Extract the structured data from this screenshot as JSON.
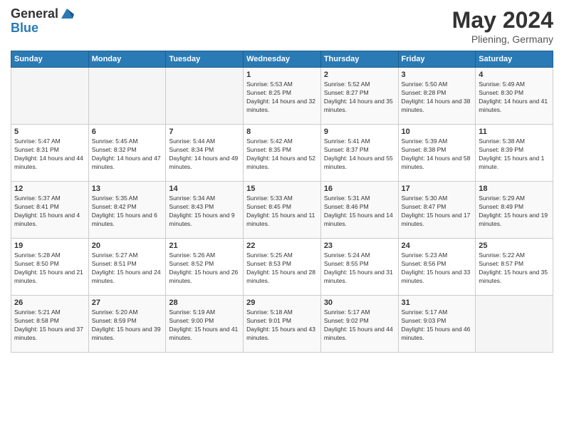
{
  "logo": {
    "general": "General",
    "blue": "Blue"
  },
  "title": {
    "month": "May 2024",
    "location": "Pliening, Germany"
  },
  "weekdays": [
    "Sunday",
    "Monday",
    "Tuesday",
    "Wednesday",
    "Thursday",
    "Friday",
    "Saturday"
  ],
  "weeks": [
    [
      {
        "day": "",
        "sunrise": "",
        "sunset": "",
        "daylight": ""
      },
      {
        "day": "",
        "sunrise": "",
        "sunset": "",
        "daylight": ""
      },
      {
        "day": "",
        "sunrise": "",
        "sunset": "",
        "daylight": ""
      },
      {
        "day": "1",
        "sunrise": "Sunrise: 5:53 AM",
        "sunset": "Sunset: 8:25 PM",
        "daylight": "Daylight: 14 hours and 32 minutes."
      },
      {
        "day": "2",
        "sunrise": "Sunrise: 5:52 AM",
        "sunset": "Sunset: 8:27 PM",
        "daylight": "Daylight: 14 hours and 35 minutes."
      },
      {
        "day": "3",
        "sunrise": "Sunrise: 5:50 AM",
        "sunset": "Sunset: 8:28 PM",
        "daylight": "Daylight: 14 hours and 38 minutes."
      },
      {
        "day": "4",
        "sunrise": "Sunrise: 5:49 AM",
        "sunset": "Sunset: 8:30 PM",
        "daylight": "Daylight: 14 hours and 41 minutes."
      }
    ],
    [
      {
        "day": "5",
        "sunrise": "Sunrise: 5:47 AM",
        "sunset": "Sunset: 8:31 PM",
        "daylight": "Daylight: 14 hours and 44 minutes."
      },
      {
        "day": "6",
        "sunrise": "Sunrise: 5:45 AM",
        "sunset": "Sunset: 8:32 PM",
        "daylight": "Daylight: 14 hours and 47 minutes."
      },
      {
        "day": "7",
        "sunrise": "Sunrise: 5:44 AM",
        "sunset": "Sunset: 8:34 PM",
        "daylight": "Daylight: 14 hours and 49 minutes."
      },
      {
        "day": "8",
        "sunrise": "Sunrise: 5:42 AM",
        "sunset": "Sunset: 8:35 PM",
        "daylight": "Daylight: 14 hours and 52 minutes."
      },
      {
        "day": "9",
        "sunrise": "Sunrise: 5:41 AM",
        "sunset": "Sunset: 8:37 PM",
        "daylight": "Daylight: 14 hours and 55 minutes."
      },
      {
        "day": "10",
        "sunrise": "Sunrise: 5:39 AM",
        "sunset": "Sunset: 8:38 PM",
        "daylight": "Daylight: 14 hours and 58 minutes."
      },
      {
        "day": "11",
        "sunrise": "Sunrise: 5:38 AM",
        "sunset": "Sunset: 8:39 PM",
        "daylight": "Daylight: 15 hours and 1 minute."
      }
    ],
    [
      {
        "day": "12",
        "sunrise": "Sunrise: 5:37 AM",
        "sunset": "Sunset: 8:41 PM",
        "daylight": "Daylight: 15 hours and 4 minutes."
      },
      {
        "day": "13",
        "sunrise": "Sunrise: 5:35 AM",
        "sunset": "Sunset: 8:42 PM",
        "daylight": "Daylight: 15 hours and 6 minutes."
      },
      {
        "day": "14",
        "sunrise": "Sunrise: 5:34 AM",
        "sunset": "Sunset: 8:43 PM",
        "daylight": "Daylight: 15 hours and 9 minutes."
      },
      {
        "day": "15",
        "sunrise": "Sunrise: 5:33 AM",
        "sunset": "Sunset: 8:45 PM",
        "daylight": "Daylight: 15 hours and 11 minutes."
      },
      {
        "day": "16",
        "sunrise": "Sunrise: 5:31 AM",
        "sunset": "Sunset: 8:46 PM",
        "daylight": "Daylight: 15 hours and 14 minutes."
      },
      {
        "day": "17",
        "sunrise": "Sunrise: 5:30 AM",
        "sunset": "Sunset: 8:47 PM",
        "daylight": "Daylight: 15 hours and 17 minutes."
      },
      {
        "day": "18",
        "sunrise": "Sunrise: 5:29 AM",
        "sunset": "Sunset: 8:49 PM",
        "daylight": "Daylight: 15 hours and 19 minutes."
      }
    ],
    [
      {
        "day": "19",
        "sunrise": "Sunrise: 5:28 AM",
        "sunset": "Sunset: 8:50 PM",
        "daylight": "Daylight: 15 hours and 21 minutes."
      },
      {
        "day": "20",
        "sunrise": "Sunrise: 5:27 AM",
        "sunset": "Sunset: 8:51 PM",
        "daylight": "Daylight: 15 hours and 24 minutes."
      },
      {
        "day": "21",
        "sunrise": "Sunrise: 5:26 AM",
        "sunset": "Sunset: 8:52 PM",
        "daylight": "Daylight: 15 hours and 26 minutes."
      },
      {
        "day": "22",
        "sunrise": "Sunrise: 5:25 AM",
        "sunset": "Sunset: 8:53 PM",
        "daylight": "Daylight: 15 hours and 28 minutes."
      },
      {
        "day": "23",
        "sunrise": "Sunrise: 5:24 AM",
        "sunset": "Sunset: 8:55 PM",
        "daylight": "Daylight: 15 hours and 31 minutes."
      },
      {
        "day": "24",
        "sunrise": "Sunrise: 5:23 AM",
        "sunset": "Sunset: 8:56 PM",
        "daylight": "Daylight: 15 hours and 33 minutes."
      },
      {
        "day": "25",
        "sunrise": "Sunrise: 5:22 AM",
        "sunset": "Sunset: 8:57 PM",
        "daylight": "Daylight: 15 hours and 35 minutes."
      }
    ],
    [
      {
        "day": "26",
        "sunrise": "Sunrise: 5:21 AM",
        "sunset": "Sunset: 8:58 PM",
        "daylight": "Daylight: 15 hours and 37 minutes."
      },
      {
        "day": "27",
        "sunrise": "Sunrise: 5:20 AM",
        "sunset": "Sunset: 8:59 PM",
        "daylight": "Daylight: 15 hours and 39 minutes."
      },
      {
        "day": "28",
        "sunrise": "Sunrise: 5:19 AM",
        "sunset": "Sunset: 9:00 PM",
        "daylight": "Daylight: 15 hours and 41 minutes."
      },
      {
        "day": "29",
        "sunrise": "Sunrise: 5:18 AM",
        "sunset": "Sunset: 9:01 PM",
        "daylight": "Daylight: 15 hours and 43 minutes."
      },
      {
        "day": "30",
        "sunrise": "Sunrise: 5:17 AM",
        "sunset": "Sunset: 9:02 PM",
        "daylight": "Daylight: 15 hours and 44 minutes."
      },
      {
        "day": "31",
        "sunrise": "Sunrise: 5:17 AM",
        "sunset": "Sunset: 9:03 PM",
        "daylight": "Daylight: 15 hours and 46 minutes."
      },
      {
        "day": "",
        "sunrise": "",
        "sunset": "",
        "daylight": ""
      }
    ]
  ]
}
